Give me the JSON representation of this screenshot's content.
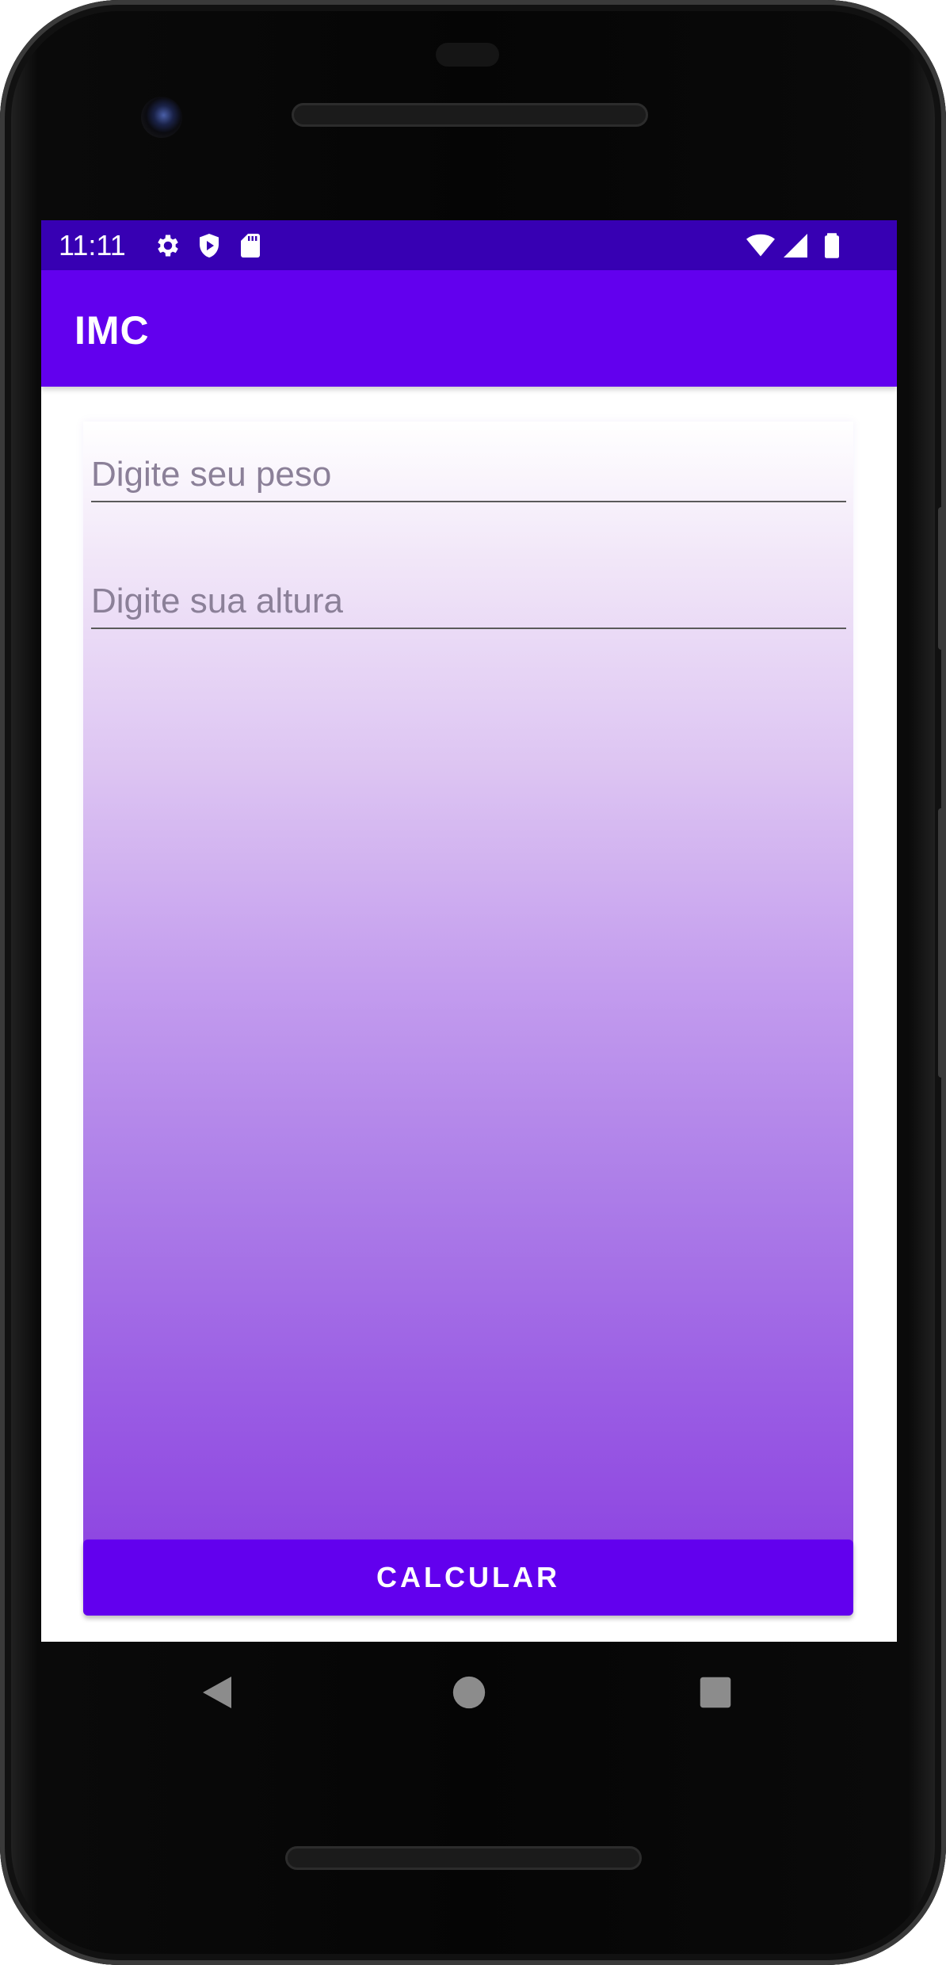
{
  "status_bar": {
    "time": "11:11",
    "left_icons": [
      "gear-icon",
      "shield-play-icon",
      "sd-card-icon"
    ],
    "right_icons": [
      "wifi-icon",
      "cell-signal-icon",
      "battery-icon"
    ]
  },
  "app_bar": {
    "title": "IMC"
  },
  "form": {
    "weight_placeholder": "Digite seu peso",
    "height_placeholder": "Digite sua altura",
    "weight_value": "",
    "height_value": "",
    "calculate_label": "CALCULAR"
  },
  "navigation": {
    "buttons": [
      "back-icon",
      "home-icon",
      "recents-icon"
    ]
  },
  "colors": {
    "primary": "#6200ee",
    "primary_dark": "#3700b3",
    "gradient_end": "#8a3fe0"
  }
}
